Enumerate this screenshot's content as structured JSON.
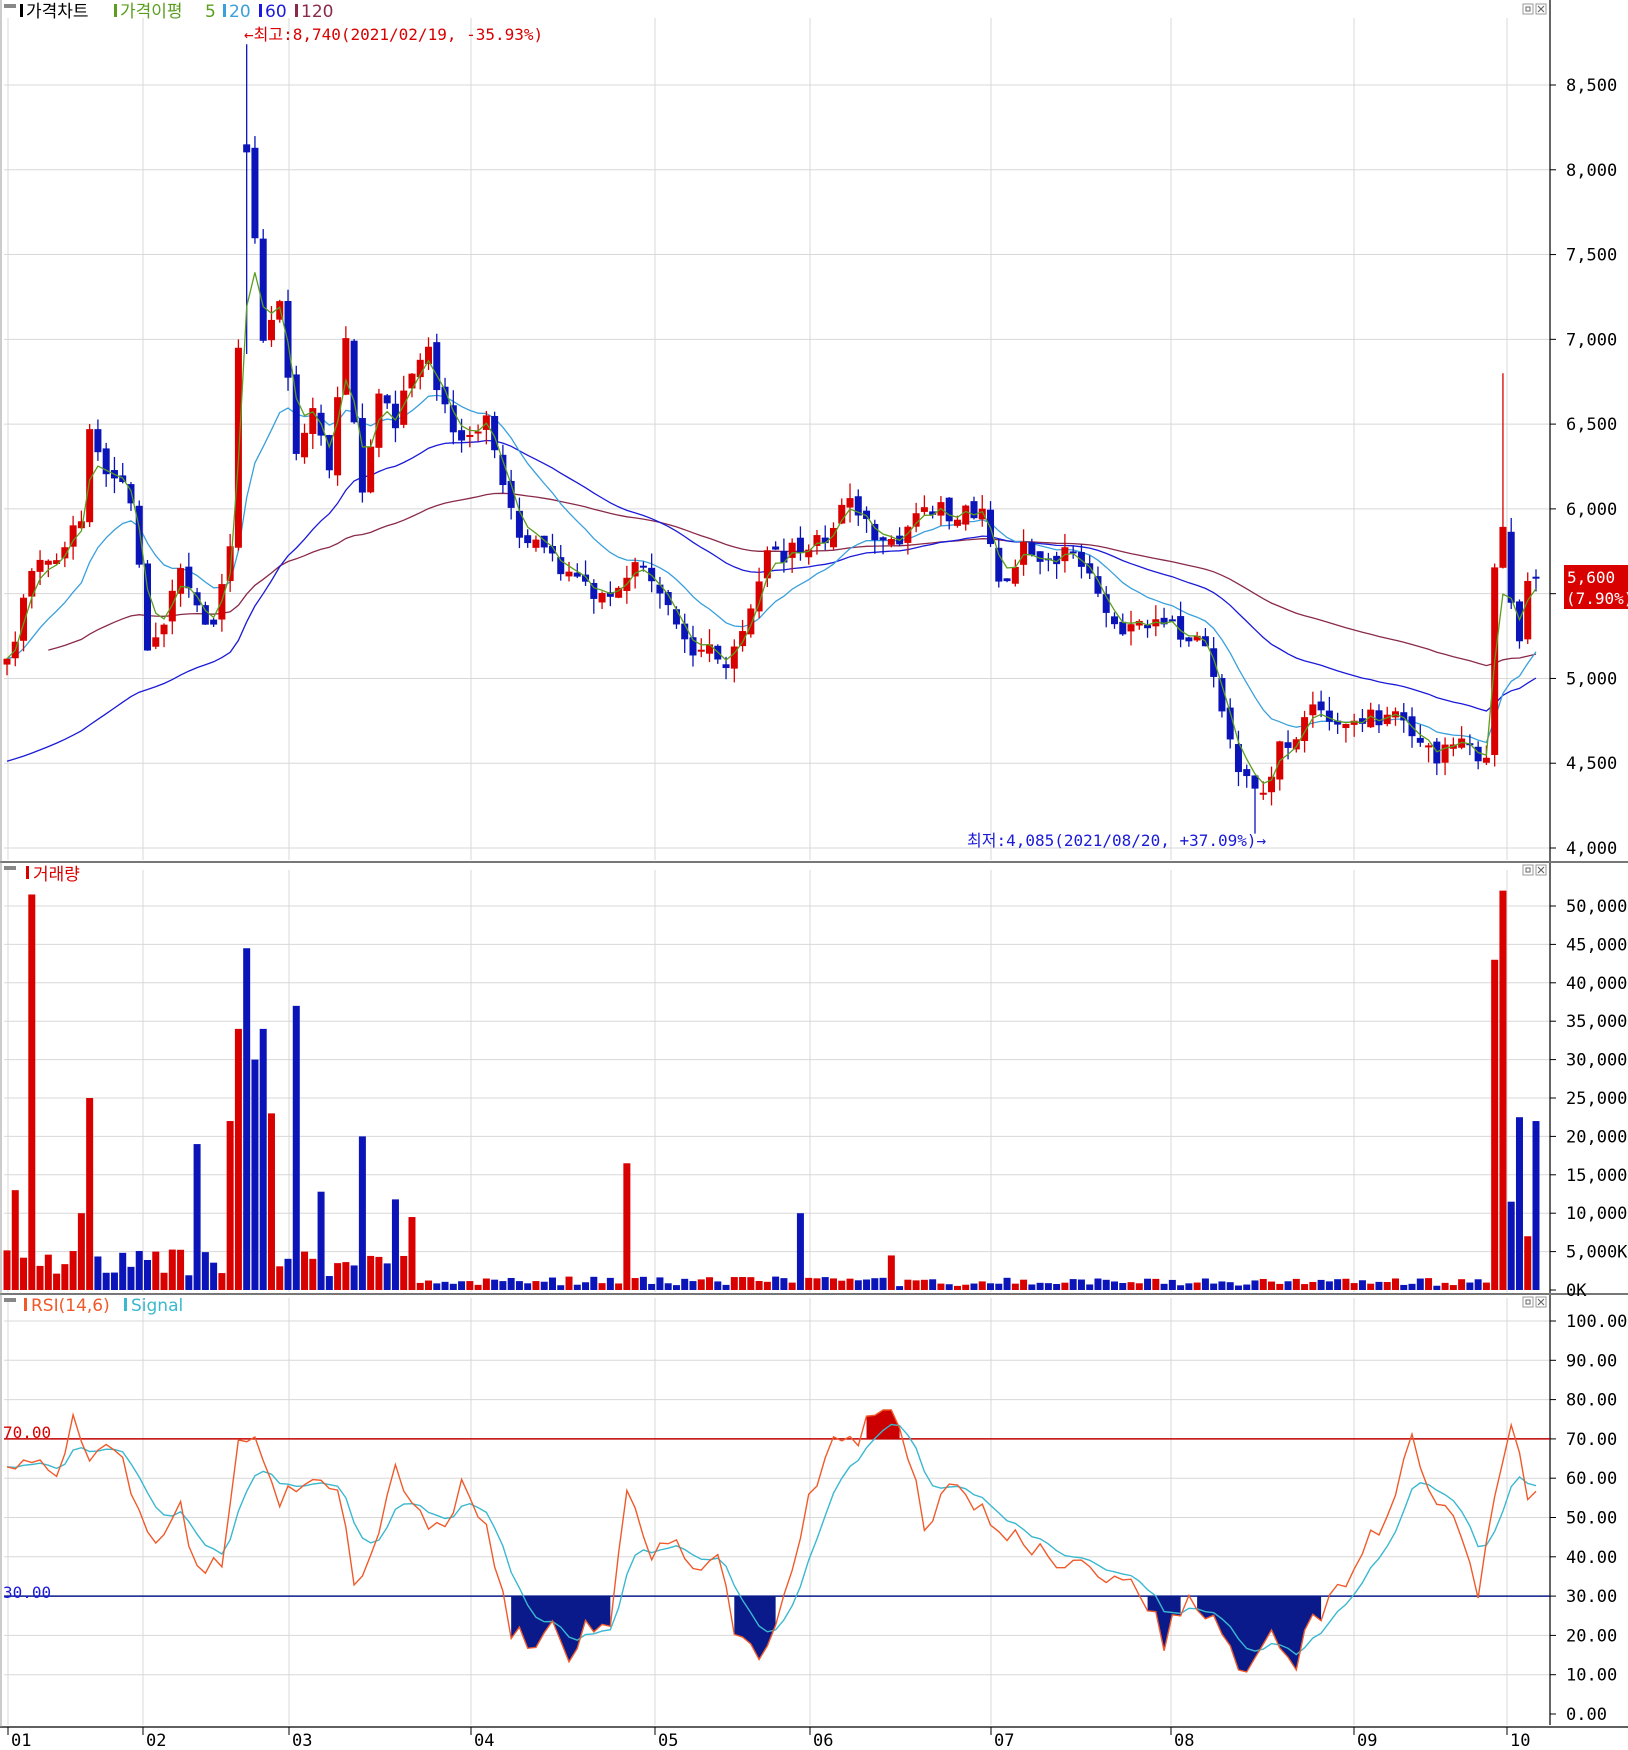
{
  "colors": {
    "up": "#d90000",
    "down": "#0a14b8",
    "ma5": "#5a9e1e",
    "ma20": "#3aa0dc",
    "ma60": "#1a1ad8",
    "ma120": "#8a2a4a",
    "rsi": "#f05a2a",
    "signal": "#3ab8d0",
    "grid": "#d8d8d8",
    "overbought_fill": "#cc0000",
    "oversold_fill": "#0a1a8a"
  },
  "icons": [
    "restore-icon",
    "close-icon"
  ],
  "price_panel": {
    "title": "가격차트",
    "ma_title": "가격이평",
    "ma_periods": [
      "5",
      "20",
      "60",
      "120"
    ],
    "high_note": "←최고:8,740(2021/02/19, -35.93%)",
    "low_note": "최저:4,085(2021/08/20, +37.09%)→",
    "last_price": "5,600",
    "last_change": "(7.90%)",
    "y_ticks": [
      "8,500",
      "8,000",
      "7,500",
      "7,000",
      "6,500",
      "6,000",
      "5,500",
      "5,000",
      "4,500",
      "4,000"
    ]
  },
  "volume_panel": {
    "title": "거래량",
    "y_ticks": [
      "50,000K",
      "45,000K",
      "40,000K",
      "35,000K",
      "30,000K",
      "25,000K",
      "20,000K",
      "15,000K",
      "10,000K",
      "5,000K",
      "0K"
    ]
  },
  "rsi_panel": {
    "title": "RSI(14,6)",
    "signal_title": "Signal",
    "upper_label": "70.00",
    "lower_label": "30.00",
    "y_ticks": [
      "100.00",
      "90.00",
      "80.00",
      "70.00",
      "60.00",
      "50.00",
      "40.00",
      "30.00",
      "20.00",
      "10.00",
      "0.00"
    ]
  },
  "x_ticks": [
    "01",
    "02",
    "03",
    "04",
    "05",
    "06",
    "07",
    "08",
    "09",
    "10"
  ],
  "chart_data": [
    {
      "type": "candlestick",
      "title": "가격차트",
      "ylim": [
        4000,
        8900
      ],
      "ohlc_anchors": [
        [
          0,
          5100
        ],
        [
          3,
          5600
        ],
        [
          6,
          5750
        ],
        [
          9,
          5900
        ],
        [
          10,
          6500
        ],
        [
          12,
          6250
        ],
        [
          15,
          6050
        ],
        [
          17,
          5200
        ],
        [
          19,
          5300
        ],
        [
          21,
          5650
        ],
        [
          23,
          5400
        ],
        [
          25,
          5300
        ],
        [
          27,
          5800
        ],
        [
          29,
          8100
        ],
        [
          31,
          7000
        ],
        [
          33,
          7200
        ],
        [
          35,
          6300
        ],
        [
          37,
          6600
        ],
        [
          39,
          6250
        ],
        [
          41,
          6950
        ],
        [
          43,
          6150
        ],
        [
          45,
          6700
        ],
        [
          47,
          6500
        ],
        [
          49,
          6850
        ],
        [
          51,
          6900
        ],
        [
          53,
          6600
        ],
        [
          55,
          6400
        ],
        [
          58,
          6500
        ],
        [
          60,
          6150
        ],
        [
          62,
          5850
        ],
        [
          64,
          5800
        ],
        [
          67,
          5650
        ],
        [
          70,
          5550
        ],
        [
          73,
          5450
        ],
        [
          76,
          5700
        ],
        [
          79,
          5550
        ],
        [
          82,
          5200
        ],
        [
          85,
          5150
        ],
        [
          87,
          5050
        ],
        [
          89,
          5300
        ],
        [
          92,
          5700
        ],
        [
          95,
          5750
        ],
        [
          99,
          5800
        ],
        [
          102,
          6050
        ],
        [
          105,
          5850
        ],
        [
          108,
          5850
        ],
        [
          111,
          6050
        ],
        [
          114,
          5950
        ],
        [
          116,
          6000
        ],
        [
          118,
          5950
        ],
        [
          120,
          5550
        ],
        [
          123,
          5750
        ],
        [
          126,
          5700
        ],
        [
          129,
          5750
        ],
        [
          132,
          5500
        ],
        [
          135,
          5300
        ],
        [
          138,
          5350
        ],
        [
          141,
          5300
        ],
        [
          144,
          5250
        ],
        [
          146,
          5050
        ],
        [
          148,
          4600
        ],
        [
          150,
          4400
        ],
        [
          152,
          4300
        ],
        [
          154,
          4600
        ],
        [
          156,
          4700
        ],
        [
          158,
          4900
        ],
        [
          161,
          4750
        ],
        [
          164,
          4750
        ],
        [
          167,
          4800
        ],
        [
          170,
          4650
        ],
        [
          173,
          4550
        ],
        [
          176,
          4600
        ],
        [
          179,
          4500
        ],
        [
          180,
          5600
        ],
        [
          181,
          5900
        ],
        [
          182,
          5500
        ],
        [
          183,
          5200
        ],
        [
          184,
          5550
        ],
        [
          185,
          5600
        ]
      ],
      "series": [
        {
          "name": "5",
          "period": 5
        },
        {
          "name": "20",
          "period": 20
        },
        {
          "name": "60",
          "period": 60
        },
        {
          "name": "120",
          "period": 120
        }
      ],
      "high": {
        "value": 8740,
        "date": "2021/02/19"
      },
      "low": {
        "value": 4085,
        "date": "2021/08/20"
      },
      "last": {
        "value": 5600,
        "change_pct": 7.9
      }
    },
    {
      "type": "bar",
      "title": "거래량",
      "unit": "K",
      "ylim": [
        0,
        53000
      ],
      "spikes": [
        [
          1,
          13000
        ],
        [
          3,
          51500
        ],
        [
          9,
          10000
        ],
        [
          10,
          25000
        ],
        [
          18,
          5000
        ],
        [
          23,
          19000
        ],
        [
          27,
          22000
        ],
        [
          28,
          34000
        ],
        [
          29,
          44500
        ],
        [
          30,
          30000
        ],
        [
          31,
          34000
        ],
        [
          32,
          23000
        ],
        [
          35,
          37000
        ],
        [
          38,
          12800
        ],
        [
          43,
          20000
        ],
        [
          47,
          11800
        ],
        [
          49,
          9500
        ],
        [
          75,
          16500
        ],
        [
          96,
          10000
        ],
        [
          107,
          4500
        ],
        [
          180,
          43000
        ],
        [
          181,
          52000
        ],
        [
          182,
          11500
        ],
        [
          183,
          22500
        ],
        [
          184,
          7000
        ],
        [
          185,
          22000
        ]
      ]
    },
    {
      "type": "line",
      "title": "RSI(14,6)",
      "ylim": [
        0,
        100
      ],
      "levels": [
        70,
        30
      ],
      "rsi_anchors": [
        [
          0,
          62
        ],
        [
          4,
          66
        ],
        [
          6,
          58
        ],
        [
          8,
          74
        ],
        [
          10,
          66
        ],
        [
          13,
          69
        ],
        [
          16,
          50
        ],
        [
          18,
          44
        ],
        [
          21,
          52
        ],
        [
          23,
          38
        ],
        [
          26,
          40
        ],
        [
          28,
          70
        ],
        [
          30,
          68
        ],
        [
          33,
          55
        ],
        [
          36,
          60
        ],
        [
          40,
          56
        ],
        [
          42,
          33
        ],
        [
          44,
          42
        ],
        [
          47,
          62
        ],
        [
          50,
          52
        ],
        [
          53,
          45
        ],
        [
          55,
          58
        ],
        [
          58,
          48
        ],
        [
          61,
          20
        ],
        [
          64,
          18
        ],
        [
          66,
          22
        ],
        [
          68,
          12
        ],
        [
          70,
          24
        ],
        [
          73,
          22
        ],
        [
          75,
          55
        ],
        [
          78,
          40
        ],
        [
          81,
          44
        ],
        [
          84,
          38
        ],
        [
          86,
          42
        ],
        [
          88,
          22
        ],
        [
          91,
          13
        ],
        [
          94,
          28
        ],
        [
          97,
          55
        ],
        [
          100,
          68
        ],
        [
          103,
          71
        ],
        [
          106,
          80
        ],
        [
          108,
          74
        ],
        [
          111,
          48
        ],
        [
          114,
          58
        ],
        [
          117,
          54
        ],
        [
          120,
          48
        ],
        [
          123,
          45
        ],
        [
          126,
          39
        ],
        [
          129,
          38
        ],
        [
          132,
          36
        ],
        [
          135,
          34
        ],
        [
          138,
          29
        ],
        [
          140,
          19
        ],
        [
          143,
          29
        ],
        [
          146,
          26
        ],
        [
          149,
          14
        ],
        [
          151,
          12
        ],
        [
          153,
          20
        ],
        [
          156,
          13
        ],
        [
          158,
          24
        ],
        [
          161,
          32
        ],
        [
          164,
          42
        ],
        [
          167,
          50
        ],
        [
          170,
          70
        ],
        [
          172,
          55
        ],
        [
          175,
          48
        ],
        [
          178,
          32
        ],
        [
          180,
          55
        ],
        [
          182,
          71
        ],
        [
          184,
          56
        ],
        [
          186,
          62
        ]
      ]
    }
  ]
}
